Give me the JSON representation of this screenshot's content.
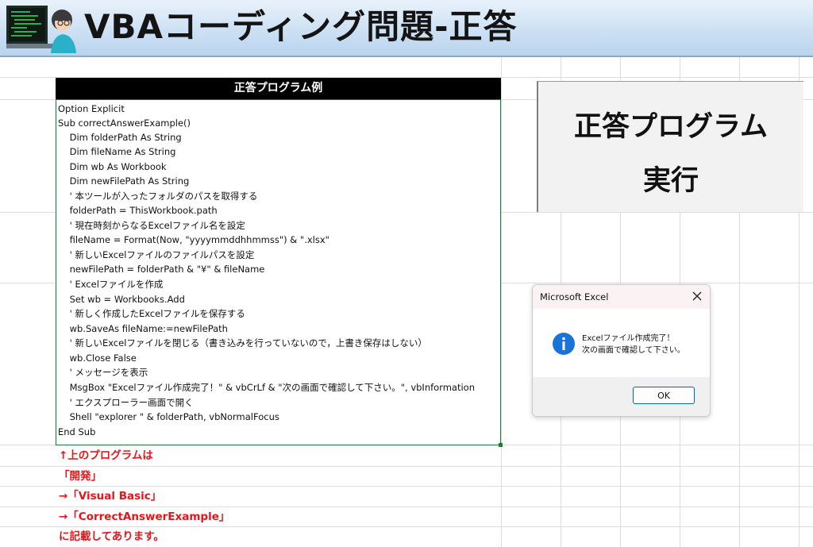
{
  "header": {
    "title": "VBAコーディング問題-正答",
    "illustration": "programmer-illustration"
  },
  "code_panel": {
    "header": "正答プログラム例",
    "lines": [
      "Option Explicit",
      "Sub correctAnswerExample()",
      "    Dim folderPath As String",
      "    Dim fileName As String",
      "    Dim wb As Workbook",
      "    Dim newFilePath As String",
      "    ' 本ツールが入ったフォルダのパスを取得する",
      "    folderPath = ThisWorkbook.path",
      "    ' 現在時刻からなるExcelファイル名を設定",
      "    fileName = Format(Now, \"yyyymmddhhmmss\") & \".xlsx\"",
      "    ' 新しいExcelファイルのファイルパスを設定",
      "    newFilePath = folderPath & \"¥\" & fileName",
      "    ' Excelファイルを作成",
      "    Set wb = Workbooks.Add",
      "    ' 新しく作成したExcelファイルを保存する",
      "    wb.SaveAs fileName:=newFilePath",
      "    ' 新しいExcelファイルを閉じる（書き込みを行っていないので，上書き保存はしない）",
      "    wb.Close False",
      "    ' メッセージを表示",
      "    MsgBox \"Excelファイル作成完了！\" & vbCrLf & \"次の画面で確認して下さい。\", vbInformation",
      "    ' エクスプローラー画面で開く",
      "    Shell \"explorer \" & folderPath, vbNormalFocus",
      "End Sub"
    ]
  },
  "notes": [
    "↑上のプログラムは",
    "「開発」",
    "→「Visual Basic」",
    "→「CorrectAnswerExample」",
    "に記載してあります。"
  ],
  "run_button": {
    "line1": "正答プログラム",
    "line2": "実行"
  },
  "msgbox": {
    "title": "Microsoft Excel",
    "icon": "info-icon",
    "message_line1": "Excelファイル作成完了！",
    "message_line2": "次の画面で確認して下さい。",
    "ok_label": "OK"
  },
  "colors": {
    "note_red": "#e8141b",
    "header_blue": "#cde1f4",
    "code_border": "#1f7a3a",
    "info_blue": "#1a73d9"
  }
}
